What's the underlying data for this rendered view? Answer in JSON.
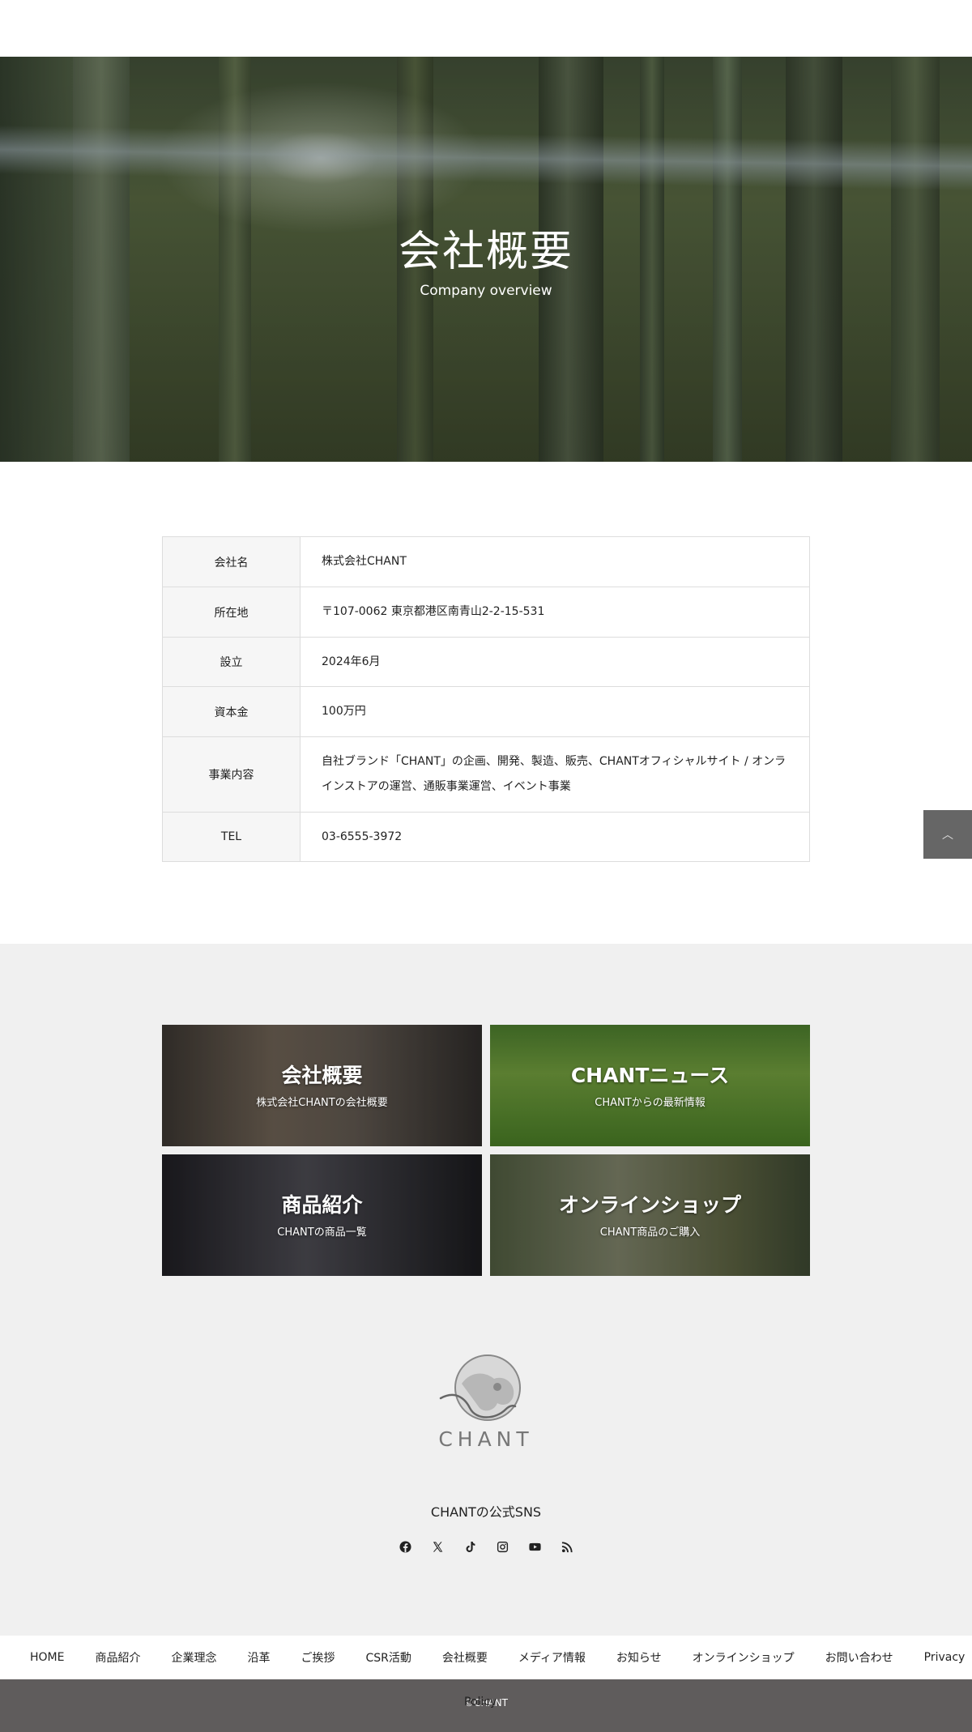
{
  "hero": {
    "title": "会社概要",
    "subtitle": "Company overview"
  },
  "company_table": {
    "rows": [
      {
        "label": "会社名",
        "value": "株式会社CHANT"
      },
      {
        "label": "所在地",
        "value": "〒107-0062 東京都港区南青山2-2-15-531"
      },
      {
        "label": "設立",
        "value": "2024年6月"
      },
      {
        "label": "資本金",
        "value": "100万円"
      },
      {
        "label": "事業内容",
        "value_line1": "自社ブランド「CHANT」の企画、開発、製造、販売、CHANTオフィシャルサイト / オンラ",
        "value_line2": "インストアの運営、通販事業運営、イベント事業"
      },
      {
        "label": "TEL",
        "value": "03-6555-3972"
      }
    ]
  },
  "back_to_top": {
    "icon": "chevron-up-icon",
    "glyph": "︿"
  },
  "cards": [
    {
      "title": "会社概要",
      "subtitle": "株式会社CHANTの会社概要"
    },
    {
      "title": "CHANTニュース",
      "subtitle": "CHANTからの最新情報"
    },
    {
      "title": "商品紹介",
      "subtitle": "CHANTの商品一覧"
    },
    {
      "title": "オンラインショップ",
      "subtitle": "CHANT商品のご購入"
    }
  ],
  "logo": {
    "brand": "CHANT"
  },
  "sns": {
    "title": "CHANTの公式SNS",
    "icons": [
      "facebook-icon",
      "x-icon",
      "tiktok-icon",
      "instagram-icon",
      "youtube-icon",
      "rss-icon"
    ]
  },
  "footer_nav": [
    "HOME",
    "商品紹介",
    "企業理念",
    "沿革",
    "ご挨拶",
    "CSR活動",
    "会社概要",
    "メディア情報",
    "お知らせ",
    "オンラインショップ",
    "お問い合わせ",
    "Privacy",
    "Policy"
  ],
  "copyright": "©CHANT"
}
